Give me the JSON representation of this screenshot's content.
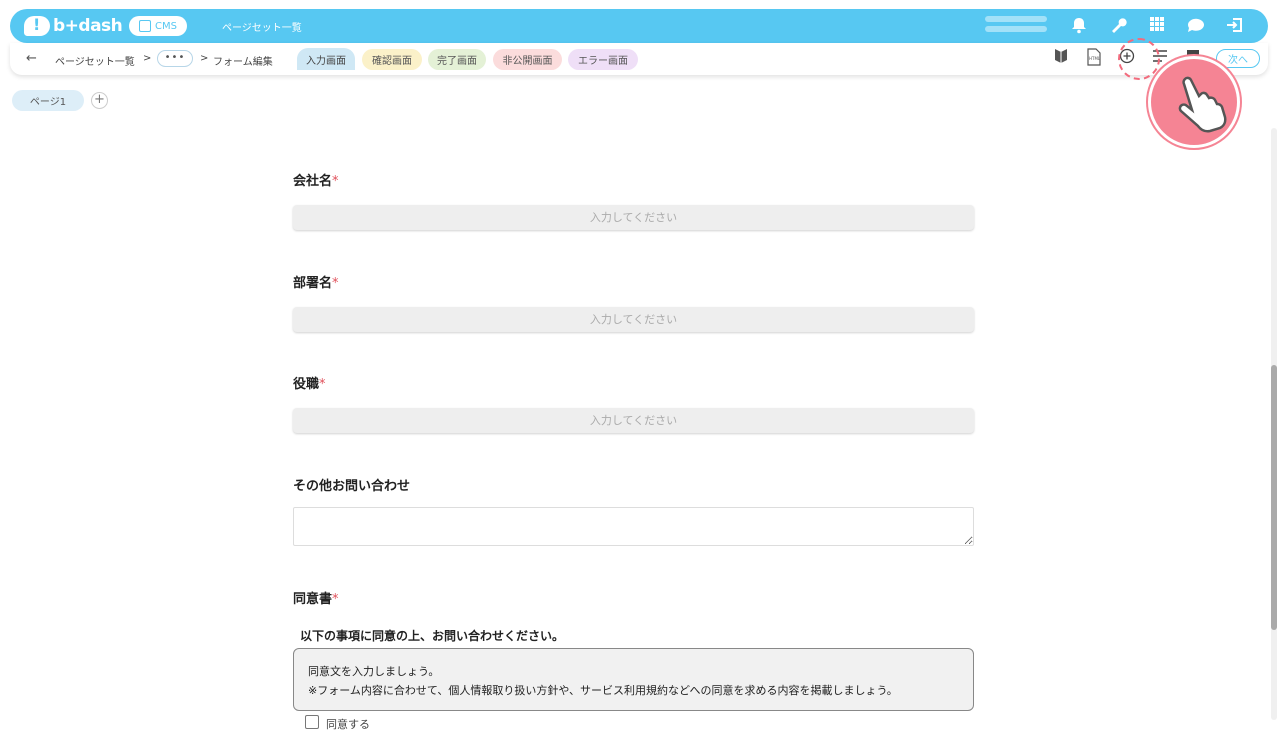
{
  "topbar": {
    "logo_text": "b+dash",
    "logo_mark": "!",
    "cms_label": "CMS",
    "title": "ページセット一覧",
    "icons": [
      "bell-icon",
      "wrench-icon",
      "grid-icon",
      "help-icon",
      "logout-icon"
    ]
  },
  "subbar": {
    "breadcrumb": [
      "ページセット一覧",
      "フォーム編集"
    ],
    "more_label": "•••",
    "separator": ">",
    "tabs": [
      {
        "label": "入力画面",
        "color": "#cfe8f5"
      },
      {
        "label": "確認画面",
        "color": "#fbf1c9"
      },
      {
        "label": "完了画面",
        "color": "#e4f1d6"
      },
      {
        "label": "非公開画面",
        "color": "#fbdcdc"
      },
      {
        "label": "エラー画面",
        "color": "#efdff7"
      }
    ],
    "next_label": "次へ"
  },
  "pages": {
    "tab_label": "ページ1",
    "add_label": "+"
  },
  "form": {
    "fields": [
      {
        "label": "会社名",
        "required": "*",
        "placeholder": "入力してください"
      },
      {
        "label": "部署名",
        "required": "*",
        "placeholder": "入力してください"
      },
      {
        "label": "役職",
        "required": "*",
        "placeholder": "入力してください"
      }
    ],
    "inquiry_label": "その他お問い合わせ",
    "consent": {
      "label": "同意書",
      "required": "*",
      "lead": "以下の事項に同意の上、お問い合わせください。",
      "body_line1": "同意文を入力しましょう。",
      "body_line2": "※フォーム内容に合わせて、個人情報取り扱い方針や、サービス利用規約などへの同意を求める内容を掲載しましょう。",
      "checkbox_label": "同意する"
    }
  },
  "colors": {
    "brand": "#57c8f2",
    "required": "#e0505a",
    "pointer": "#f58494"
  }
}
